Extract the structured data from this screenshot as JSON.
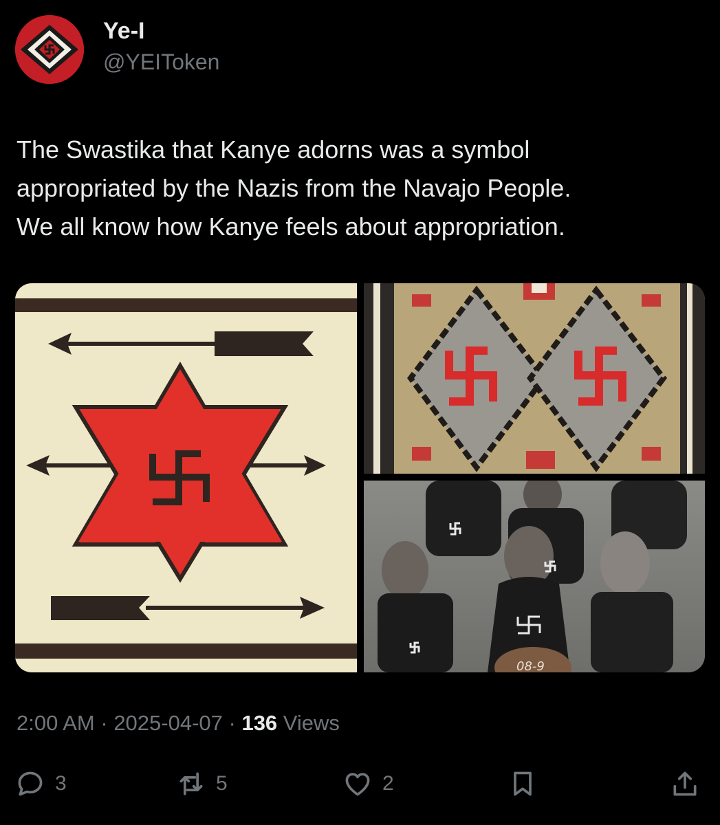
{
  "author": {
    "display_name": "Ye-I",
    "handle": "@YEIToken"
  },
  "tweet": {
    "lines": [
      "The Swastika that Kanye adorns was a symbol",
      "appropriated by the Nazis from the Navajo People.",
      "We all know how Kanye feels about appropriation."
    ]
  },
  "media": {
    "basketball_label": "08-9"
  },
  "meta": {
    "time": "2:00 AM",
    "sep1": " · ",
    "date": "2025-04-07",
    "sep2": " · ",
    "views_count": "136",
    "views_label": " Views"
  },
  "actions": {
    "replies": "3",
    "reposts": "5",
    "likes": "2"
  },
  "colors": {
    "background": "#000000",
    "text": "#e7e9ea",
    "muted": "#71767b",
    "avatar_red": "#c41f26",
    "rug_red": "#e2302b"
  },
  "icons": {
    "reply": "reply-icon",
    "repost": "repost-icon",
    "like": "heart-icon",
    "bookmark": "bookmark-icon",
    "share": "share-icon"
  }
}
